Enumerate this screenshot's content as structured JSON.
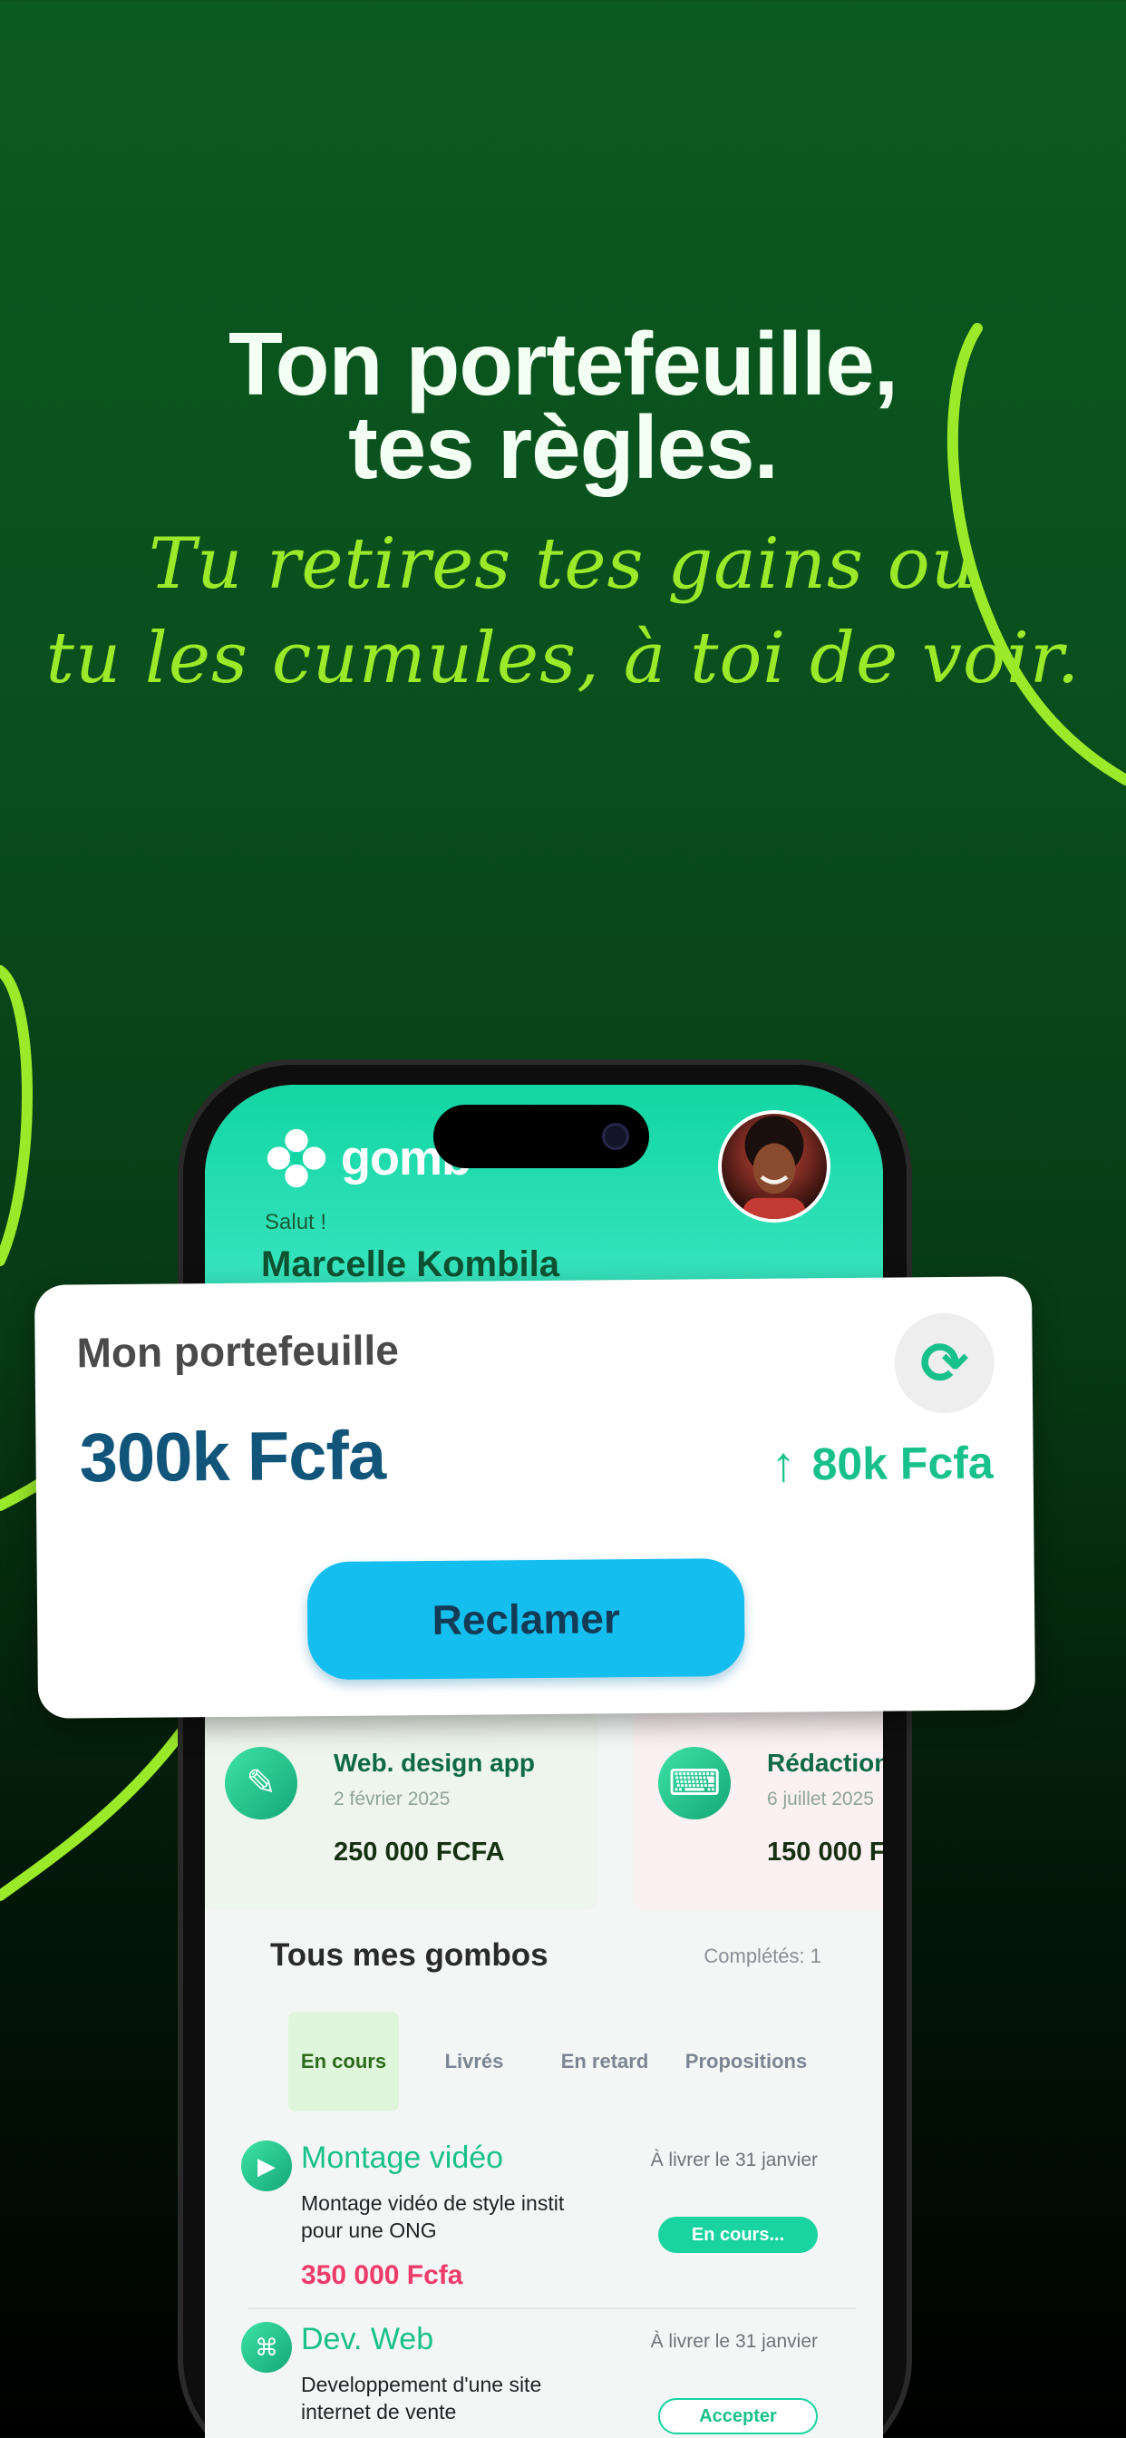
{
  "promo": {
    "headline_line1": "Ton portefeuille,",
    "headline_line2": "tes règles.",
    "tagline_line1": "Tu retires tes gains ou",
    "tagline_line2": "tu les cumules, à toi de voir."
  },
  "colors": {
    "accent_green": "#19c18a",
    "lime": "#9bea2a",
    "brand_teal": "#12d6a2",
    "claim_button": "#14bff0",
    "price_pink": "#ef3b6c",
    "balance_blue": "#11557a"
  },
  "app": {
    "brand": "gomb",
    "greeting": "Salut !",
    "user_name": "Marcelle Kombila"
  },
  "wallet": {
    "title": "Mon portefeuille",
    "balance": "300k Fcfa",
    "gain": "80k Fcfa",
    "claim_label": "Reclamer",
    "refresh_icon": "refresh-icon",
    "gain_icon": "arrow-up-icon"
  },
  "stats": [
    {
      "title": "Web. design app",
      "date": "2 février 2025",
      "amount": "250 000 FCFA",
      "icon": "pen-tool-icon"
    },
    {
      "title": "Rédaction",
      "date": "6 juillet 2025",
      "amount": "150 000 F",
      "icon": "laptop-user-icon"
    }
  ],
  "gombos": {
    "title": "Tous mes gombos",
    "completed": "Complétés: 1",
    "tabs": [
      "En cours",
      "Livrés",
      "En retard",
      "Propositions"
    ],
    "tasks": [
      {
        "title": "Montage vidéo",
        "due": "À livrer le 31 janvier",
        "desc": "Montage vidéo de style instit pour une ONG",
        "price": "350 000 Fcfa",
        "action": "En cours...",
        "icon": "video-edit-icon"
      },
      {
        "title": "Dev. Web",
        "due": "À livrer le 31 janvier",
        "desc": "Developpement d'une site internet de vente",
        "price": "",
        "action": "Accepter",
        "icon": "code-window-icon"
      }
    ]
  }
}
